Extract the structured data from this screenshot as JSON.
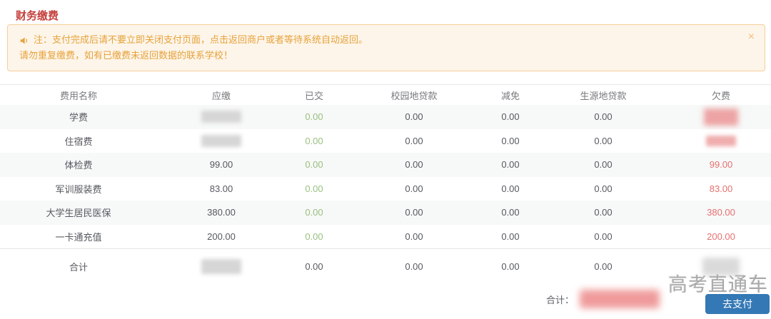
{
  "page": {
    "title": "财务缴费"
  },
  "notice": {
    "icon": "speaker-icon",
    "line1": "注：支付完成后请不要立即关闭支付页面，点击返回商户或者等待系统自动返回。",
    "line2": "请勿重复缴费，如有已缴费未返回数据的联系学校！",
    "close_label": "×"
  },
  "table": {
    "columns": [
      "费用名称",
      "应缴",
      "已交",
      "校园地贷款",
      "减免",
      "生源地贷款",
      "欠费"
    ],
    "rows": [
      {
        "name": "学费",
        "payable_redacted": true,
        "paid": "0.00",
        "campus_loan": "0.00",
        "deduction": "0.00",
        "origin_loan": "0.00",
        "owed_redacted": true
      },
      {
        "name": "住宿费",
        "payable_redacted": true,
        "paid": "0.00",
        "campus_loan": "0.00",
        "deduction": "0.00",
        "origin_loan": "0.00",
        "owed_redacted": true
      },
      {
        "name": "体检费",
        "payable": "99.00",
        "paid": "0.00",
        "campus_loan": "0.00",
        "deduction": "0.00",
        "origin_loan": "0.00",
        "owed": "99.00"
      },
      {
        "name": "军训服装费",
        "payable": "83.00",
        "paid": "0.00",
        "campus_loan": "0.00",
        "deduction": "0.00",
        "origin_loan": "0.00",
        "owed": "83.00"
      },
      {
        "name": "大学生居民医保",
        "payable": "380.00",
        "paid": "0.00",
        "campus_loan": "0.00",
        "deduction": "0.00",
        "origin_loan": "0.00",
        "owed": "380.00"
      },
      {
        "name": "一卡通充值",
        "payable": "200.00",
        "paid": "0.00",
        "campus_loan": "0.00",
        "deduction": "0.00",
        "origin_loan": "0.00",
        "owed": "200.00"
      }
    ],
    "total_row": {
      "name": "合计",
      "payable_redacted": true,
      "paid": "0.00",
      "campus_loan": "0.00",
      "deduction": "0.00",
      "origin_loan": "0.00",
      "owed_redacted": true
    }
  },
  "footer": {
    "total_label": "合计：",
    "total_redacted": true,
    "pay_button_label": "去支付",
    "watermark": "高考直通车"
  },
  "colors": {
    "title_red": "#c5403c",
    "notice_text": "#e6a23c",
    "notice_bg": "#fdf5e9",
    "notice_border": "#f6cd9a",
    "paid_green": "#99bf7f",
    "owed_red": "#e57170",
    "button_blue": "#3478b5"
  }
}
